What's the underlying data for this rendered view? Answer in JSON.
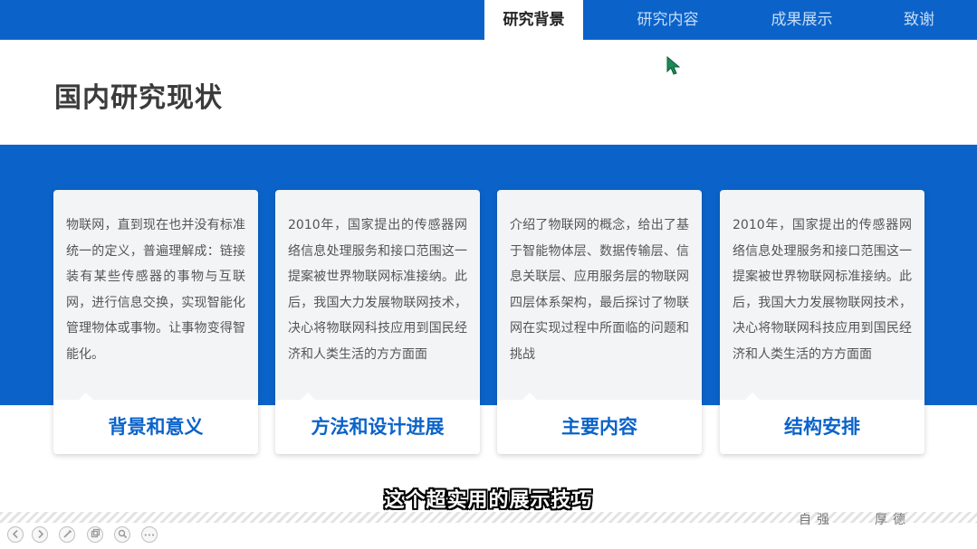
{
  "nav": {
    "tabs": [
      {
        "label": "研究背景",
        "active": true
      },
      {
        "label": "研究内容",
        "active": false
      },
      {
        "label": "成果展示",
        "active": false
      },
      {
        "label": "致谢",
        "active": false
      }
    ]
  },
  "page": {
    "title": "国内研究现状"
  },
  "cards": [
    {
      "text": "物联网，直到现在也并没有标准统一的定义，普遍理解成：链接装有某些传感器的事物与互联网，进行信息交换，实现智能化管理物体或事物。让事物变得智能化。",
      "heading": "背景和意义"
    },
    {
      "text": "2010年，国家提出的传感器网络信息处理服务和接口范围这一提案被世界物联网标准接纳。此后，我国大力发展物联网技术，决心将物联网科技应用到国民经济和人类生活的方方面面",
      "heading": "方法和设计进展"
    },
    {
      "text": "介绍了物联网的概念，给出了基于智能物体层、数据传输层、信息关联层、应用服务层的物联网四层体系架构，最后探讨了物联网在实现过程中所面临的问题和挑战",
      "heading": "主要内容"
    },
    {
      "text": "2010年，国家提出的传感器网络信息处理服务和接口范围这一提案被世界物联网标准接纳。此后，我国大力发展物联网技术，决心将物联网科技应用到国民经济和人类生活的方方面面",
      "heading": "结构安排"
    }
  ],
  "footer": {
    "left_text": "自强",
    "right_text": "厚德"
  },
  "subtitle": "这个超实用的展示技巧",
  "controls": {
    "icons": [
      "prev-icon",
      "next-icon",
      "pen-icon",
      "slides-icon",
      "zoom-icon",
      "more-icon"
    ],
    "more_label": "•••"
  },
  "colors": {
    "accent": "#0b63c9",
    "title": "#3b3b3b",
    "card_text": "#555555"
  }
}
